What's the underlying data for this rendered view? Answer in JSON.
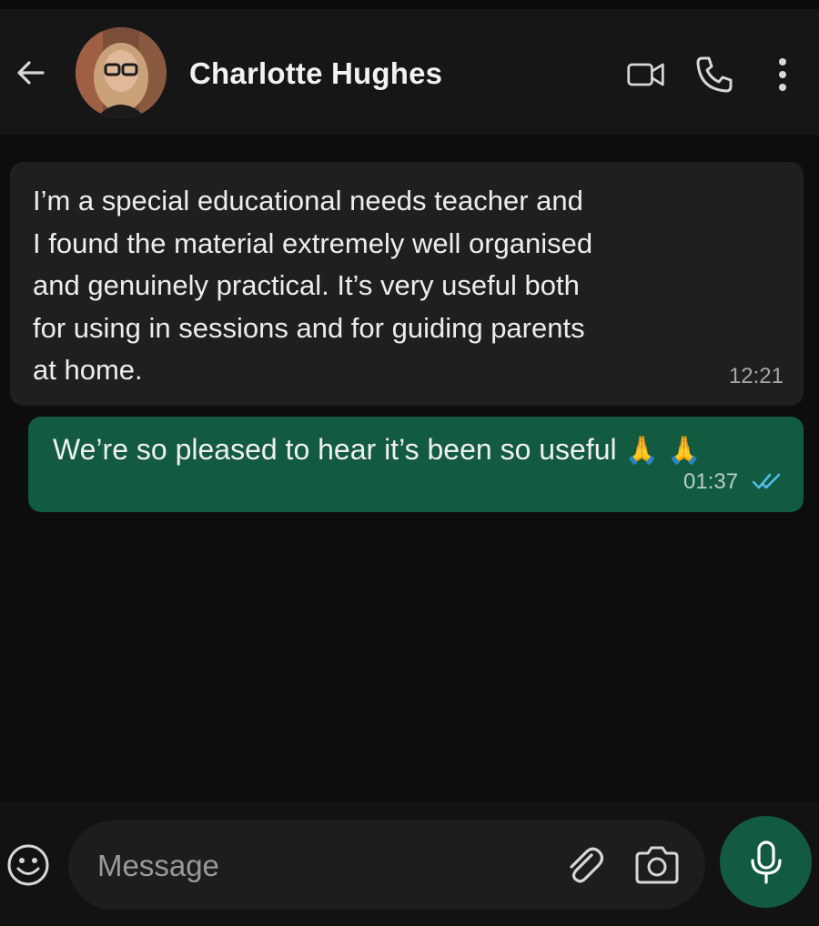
{
  "header": {
    "contact_name": "Charlotte Hughes",
    "icons": {
      "back": "arrow-left-icon",
      "video": "video-camera-icon",
      "call": "phone-icon",
      "menu": "more-vertical-icon"
    }
  },
  "messages": [
    {
      "direction": "incoming",
      "text": "I’m a special educational needs teacher and\nI found the material extremely well organised\nand genuinely practical. It’s very useful both\nfor using in sessions and for guiding parents\nat home.",
      "time": "12:21"
    },
    {
      "direction": "outgoing",
      "text": "We’re so pleased to hear it’s been so useful",
      "emoji": "🙏 🙏",
      "time": "01:37",
      "status": "read"
    }
  ],
  "composer": {
    "placeholder": "Message",
    "icons": {
      "emoji": "smiley-icon",
      "attach": "paperclip-icon",
      "camera": "camera-icon",
      "mic": "microphone-icon"
    }
  },
  "colors": {
    "header_bg": "#161616",
    "chat_bg": "#0d0d0d",
    "incoming_bubble": "#1f1f1f",
    "outgoing_bubble": "#125a40",
    "read_ticks": "#53bdeb",
    "icon": "#d7d7d7"
  }
}
